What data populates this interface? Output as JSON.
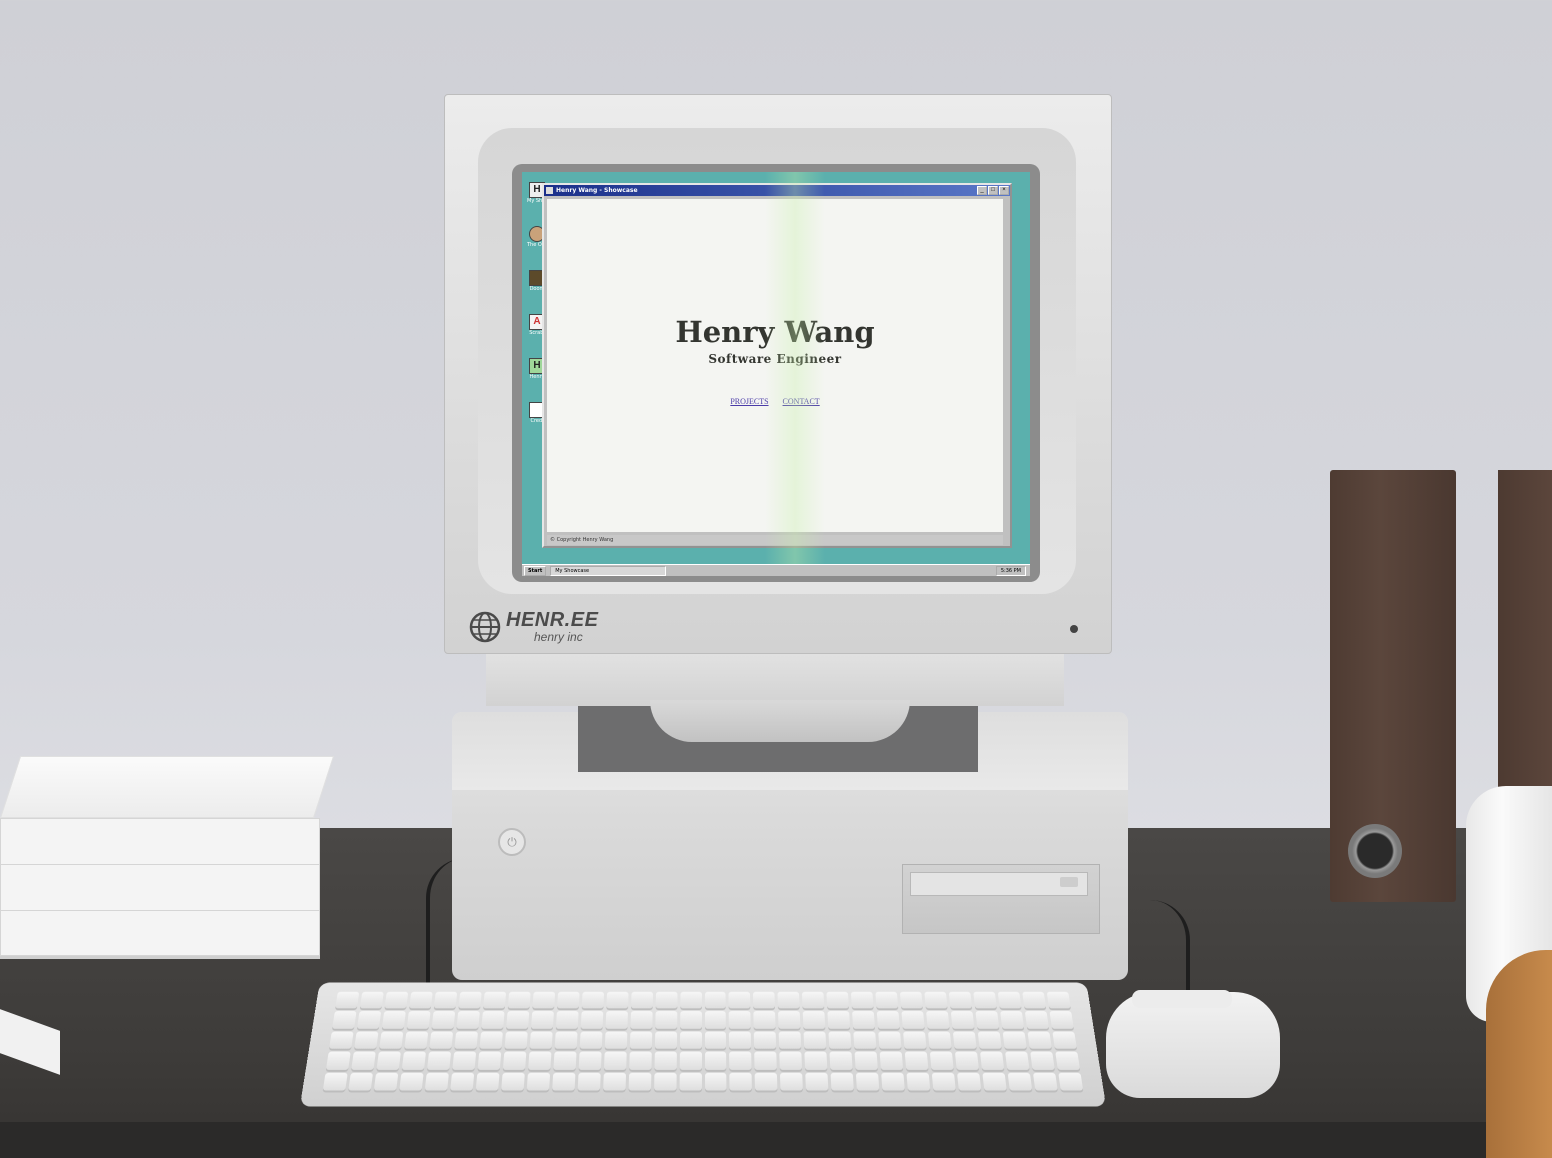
{
  "window": {
    "title": "Henry Wang - Showcase",
    "buttons": {
      "minimize": "_",
      "maximize": "□",
      "close": "×"
    },
    "status": "© Copyright Henry Wang"
  },
  "hero": {
    "name": "Henry Wang",
    "role": "Software Engineer"
  },
  "nav": {
    "projects": "PROJECTS",
    "contact": "CONTACT"
  },
  "desktop_icons": [
    {
      "label": "My Show",
      "icon": "h-logo-icon"
    },
    {
      "label": "The Ori Tod",
      "icon": "character-icon"
    },
    {
      "label": "Doom",
      "icon": "doom-icon"
    },
    {
      "label": "Scrabl",
      "icon": "scrabble-icon"
    },
    {
      "label": "Henry",
      "icon": "h-logo-icon"
    },
    {
      "label": "Credi",
      "icon": "credits-icon"
    }
  ],
  "taskbar": {
    "start": "Start",
    "task": "My Showcase",
    "clock": "5:36 PM"
  },
  "monitor_brand": {
    "name": "HENR.EE",
    "sub": "henry inc"
  },
  "colors": {
    "desktop": "#5bb0ad",
    "titlebar": "#1a2f8a",
    "link": "#4a3ba8"
  }
}
